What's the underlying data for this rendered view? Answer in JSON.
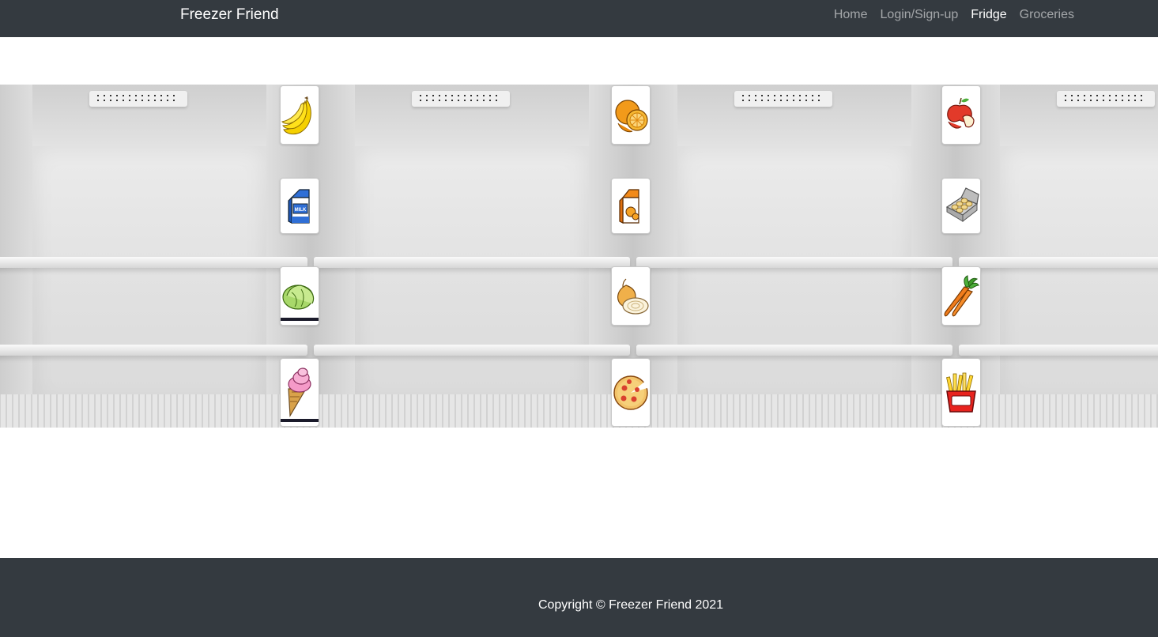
{
  "navbar": {
    "brand": "Freezer Friend",
    "links": [
      {
        "label": "Home",
        "active": false
      },
      {
        "label": "Login/Sign-up",
        "active": false
      },
      {
        "label": "Fridge",
        "active": true
      },
      {
        "label": "Groceries",
        "active": false
      }
    ]
  },
  "fridge": {
    "columns": [
      {
        "items": [
          "banana-icon",
          "milk-carton-icon",
          "lettuce-icon",
          "ice-cream-icon"
        ]
      },
      {
        "items": [
          "orange-icon",
          "orange-juice-carton-icon",
          "onion-icon",
          "pizza-icon"
        ]
      },
      {
        "items": [
          "apple-icon",
          "egg-carton-icon",
          "carrot-icon",
          "french-fries-icon"
        ]
      }
    ]
  },
  "footer": {
    "copyright": "Copyright © Freezer Friend 2021"
  },
  "colors": {
    "navbar_bg": "#343a40",
    "footer_bg": "#343a40",
    "nav_link": "rgba(255,255,255,0.55)",
    "nav_link_active": "#ffffff"
  }
}
